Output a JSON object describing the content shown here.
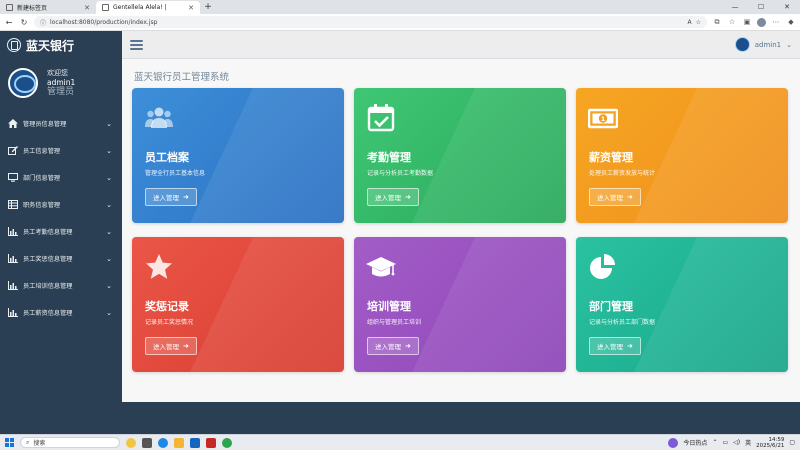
{
  "browser": {
    "tabs": [
      {
        "title": "新建标签页",
        "active": false
      },
      {
        "title": "Gentellela Alela! |",
        "active": true
      }
    ],
    "url": "localhost:8080/production/index.jsp"
  },
  "sidebar": {
    "brand": "蓝天银行",
    "profile": {
      "welcome": "欢迎您",
      "username": "admin1",
      "role": "管理员"
    },
    "items": [
      {
        "label": "管理员信息管理",
        "icon": "home-icon"
      },
      {
        "label": "员工信息管理",
        "icon": "edit-icon"
      },
      {
        "label": "部门信息管理",
        "icon": "desktop-icon"
      },
      {
        "label": "职务信息管理",
        "icon": "table-icon"
      },
      {
        "label": "员工考勤信息管理",
        "icon": "bar-chart-icon"
      },
      {
        "label": "员工奖惩信息管理",
        "icon": "bar-chart-icon"
      },
      {
        "label": "员工培训信息管理",
        "icon": "bar-chart-icon"
      },
      {
        "label": "员工薪资信息管理",
        "icon": "bar-chart-icon"
      }
    ]
  },
  "topnav": {
    "user": "admin1"
  },
  "main": {
    "title": "蓝天银行员工管理系统",
    "cards": [
      {
        "title": "员工档案",
        "desc": "管理全行员工基本信息",
        "button": "进入管理",
        "icon": "users-icon",
        "color": "#3a8ad6"
      },
      {
        "title": "考勤管理",
        "desc": "记录与分析员工考勤数据",
        "button": "进入管理",
        "icon": "calendar-check-icon",
        "color": "#34bf6c"
      },
      {
        "title": "薪资管理",
        "desc": "处理员工薪资发放与统计",
        "button": "进入管理",
        "icon": "money-icon",
        "color": "#f39c1e"
      },
      {
        "title": "奖惩记录",
        "desc": "记录员工奖惩情况",
        "button": "进入管理",
        "icon": "star-icon",
        "color": "#e24a3b"
      },
      {
        "title": "培训管理",
        "desc": "组织与管理员工培训",
        "button": "进入管理",
        "icon": "graduation-cap-icon",
        "color": "#9b55c3"
      },
      {
        "title": "部门管理",
        "desc": "记录与分析员工部门数据",
        "button": "进入管理",
        "icon": "pie-chart-icon",
        "color": "#20b595"
      }
    ]
  },
  "taskbar": {
    "search": "搜索",
    "weather": "今日热点",
    "time": "14:59",
    "date": "2025/6/21",
    "ime": "英"
  }
}
